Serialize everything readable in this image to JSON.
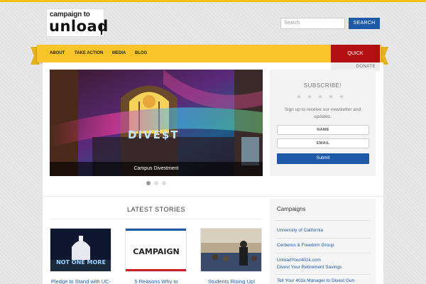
{
  "header": {
    "logo_line1": "campaign to",
    "logo_line2": "unload",
    "search_placeholder": "Search",
    "search_button": "SEARCH"
  },
  "nav": {
    "items": [
      {
        "label": "ABOUT"
      },
      {
        "label": "TAKE ACTION"
      },
      {
        "label": "MEDIA"
      },
      {
        "label": "BLOG"
      }
    ],
    "quick_label": "QUICK",
    "donate_label": "DONATE"
  },
  "slider": {
    "caption": "Campus Divestment",
    "sign_text": "DIVE$T",
    "dot_count": 3,
    "active_dot": 1
  },
  "subscribe": {
    "title": "SUBSCRIBE!",
    "stars": "★★★★★",
    "text": "Sign up to receive our newsletter and updates.",
    "name_field": "NAME",
    "email_field": "EMAIL",
    "submit": "Submit"
  },
  "latest": {
    "title": "LATEST STORIES",
    "stories": [
      {
        "title": "Pledge to Stand with UC-",
        "image_text": "NOT ONE MORE"
      },
      {
        "title": "5 Reasons Why to",
        "image_text": "CAMPAIGN"
      },
      {
        "title": "Students Rising Up!",
        "image_text": ""
      }
    ]
  },
  "campaigns": {
    "title": "Campaigns",
    "links": [
      {
        "line1": "University of California",
        "line2": ""
      },
      {
        "line1": "Cerberus & Freedom Group",
        "line2": ""
      },
      {
        "line1": "UnloadYour401k.com",
        "line2": "Divest Your Retirement Savings"
      },
      {
        "line1": "Tell Your 401k Manager to Divest Gun",
        "line2": ""
      }
    ]
  },
  "colors": {
    "accent_yellow": "#f7c52a",
    "link_blue": "#1e5aa8",
    "quick_red": "#b30f12"
  }
}
